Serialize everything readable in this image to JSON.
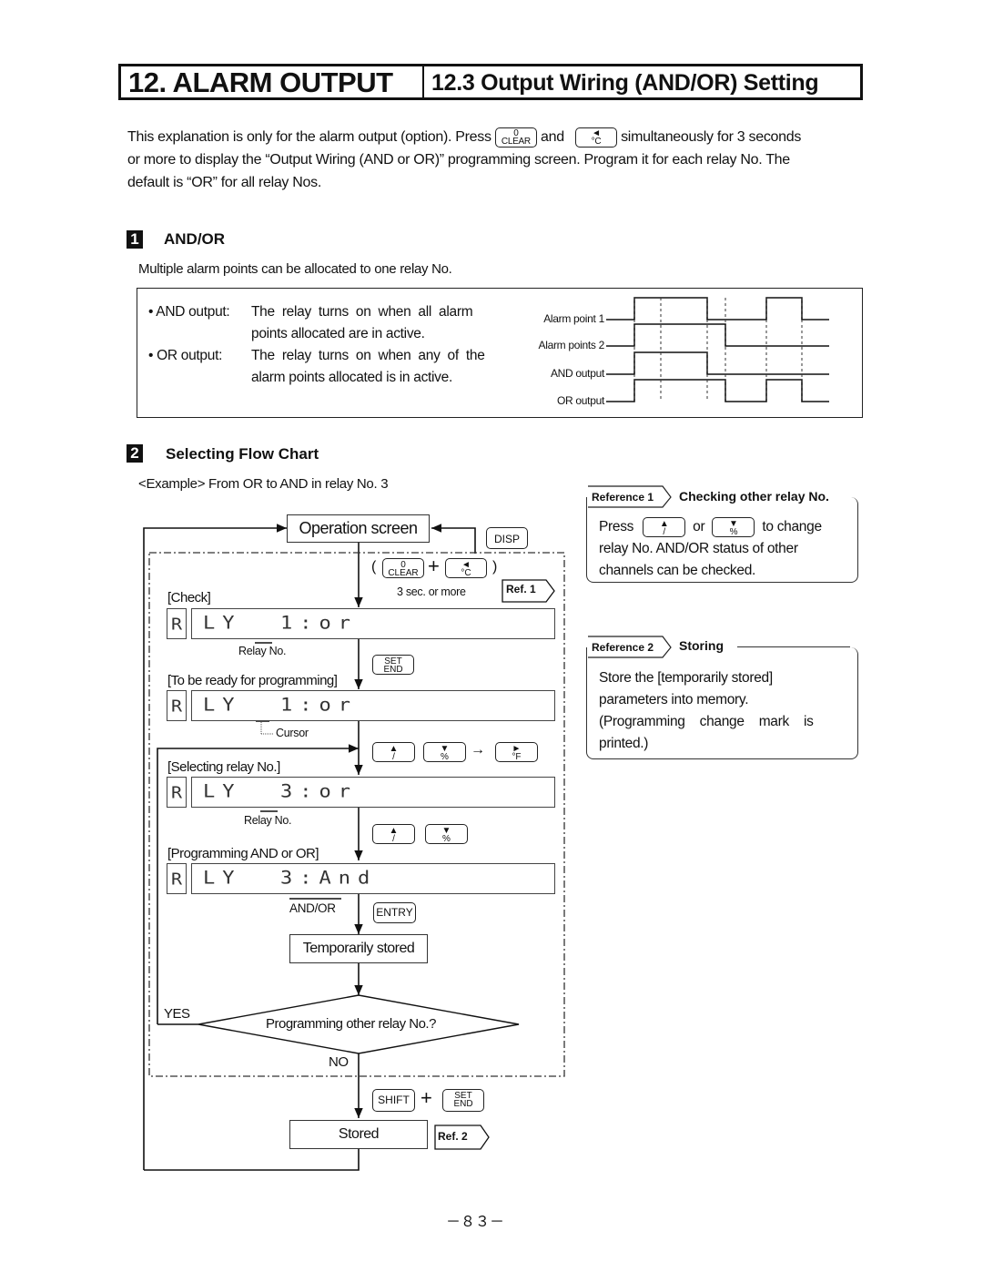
{
  "header": {
    "chapter": "12. ALARM OUTPUT",
    "section": "12.3 Output Wiring (AND/OR) Setting"
  },
  "intro": {
    "part1": "This explanation is only for the alarm output (option).   Press",
    "key_clear_top": "0",
    "key_clear_bottom": "CLEAR",
    "and": "and",
    "key_left_top": "◄",
    "key_left_bottom": "°C",
    "part2": "simultaneously for 3 seconds",
    "line2": "or more to display the “Output Wiring (AND or OR)” programming screen. Program it for each relay No. The",
    "line3": "default is “OR” for all relay Nos."
  },
  "section1": {
    "badge": "1",
    "title": "AND/OR",
    "subtitle": "Multiple alarm points can be allocated to one relay No.",
    "and_label": "• AND output:",
    "and_desc_1": "The  relay  turns  on  when  all  alarm",
    "and_desc_2": "points allocated are in active.",
    "or_label": "• OR output:",
    "or_desc_1": "The  relay  turns  on  when  any  of  the",
    "or_desc_2": "alarm points allocated is in active.",
    "timing": {
      "signals": [
        {
          "label": "Alarm point 1",
          "states": [
            0,
            1,
            1,
            1,
            0,
            0,
            1,
            0,
            0
          ]
        },
        {
          "label": "Alarm points 2",
          "states": [
            0,
            0,
            1,
            1,
            1,
            0,
            0,
            0,
            0
          ]
        },
        {
          "label": "AND output",
          "states": [
            0,
            0,
            1,
            1,
            0,
            0,
            0,
            0,
            0
          ]
        },
        {
          "label": "OR output",
          "states": [
            0,
            1,
            1,
            1,
            1,
            0,
            1,
            0,
            0
          ]
        }
      ]
    }
  },
  "section2": {
    "badge": "2",
    "title": "Selecting Flow Chart",
    "example": "<Example> From OR to AND in relay No. 3",
    "operation_screen": "Operation screen",
    "disp_key": "DISP",
    "paren_open": "(",
    "paren_close": ")",
    "plus": "+",
    "three_sec": "3 sec. or more",
    "ref1": "Ref. 1",
    "ref2": "Ref. 2",
    "check_label": "[Check]",
    "lcd_a": "R",
    "lcd1": "LY  1:or",
    "relay_no": "Relay No.",
    "set_top": "SET",
    "set_bottom": "END",
    "ready_label": "[To be ready for programming]",
    "lcd2": "LY  1:or",
    "cursor": "Cursor",
    "up_arrow": "▲",
    "up_sub": "/",
    "down_arrow": "▼",
    "down_sub": "%",
    "right_arrow": "►",
    "right_sub": "°F",
    "arrow_to": "→",
    "select_label": "[Selecting relay No.]",
    "lcd3": "LY  3:or",
    "prog_label": "[Programming AND or OR]",
    "lcd4": "LY  3:And",
    "andor": "AND/OR",
    "entry_key": "ENTRY",
    "temp_stored": "Temporarily stored",
    "yes": "YES",
    "question": "Programming other relay No.?",
    "no": "NO",
    "shift_key": "SHIFT",
    "stored": "Stored"
  },
  "reference1": {
    "tag": "Reference 1",
    "title": "Checking other relay No.",
    "press": "Press",
    "or": "or",
    "to_change": "to change",
    "line2": "relay No. AND/OR status of other",
    "line3": "channels can be checked."
  },
  "reference2": {
    "tag": "Reference 2",
    "title": "Storing",
    "line1": "Store the [temporarily stored]",
    "line2": "parameters into memory.",
    "line3": "(Programming    change    mark    is",
    "line4": "printed.)"
  },
  "footer": {
    "page_number": "－８３－"
  }
}
